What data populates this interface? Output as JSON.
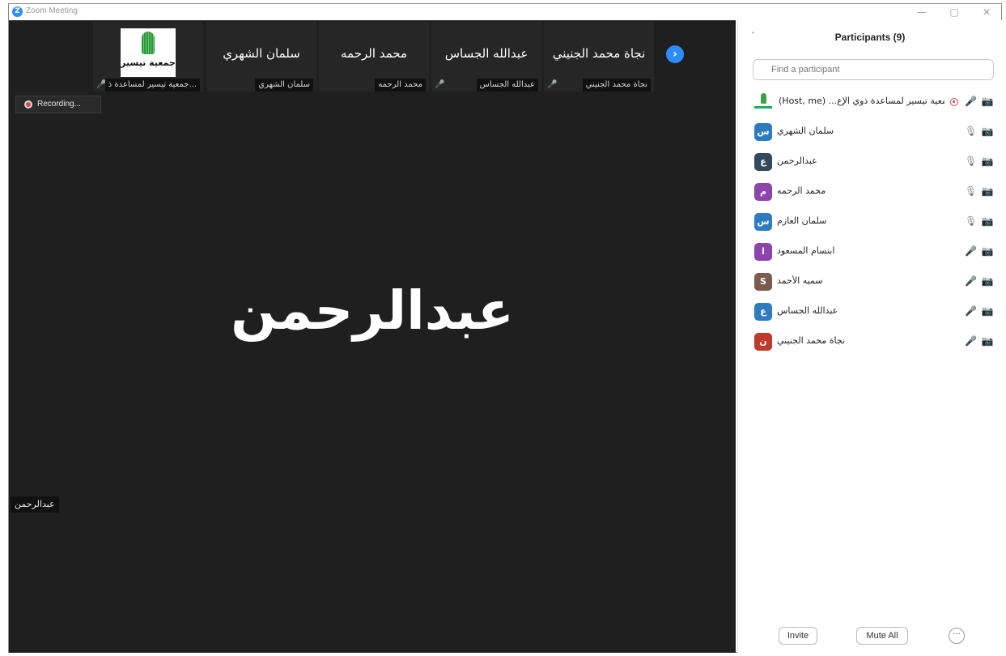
{
  "window": {
    "app_icon_glyph": "Z",
    "title": "Zoom Meeting",
    "controls": {
      "minimize": "—",
      "maximize": "▢",
      "close": "✕"
    }
  },
  "thumbnails": [
    {
      "type": "logo",
      "logo_text": "جمعية تيسير",
      "label": "...جمعية تيسير لمساعدة ذ",
      "muted": true
    },
    {
      "type": "name",
      "big_name": "سلمان الشهري",
      "label": "سلمان الشهري",
      "muted": false
    },
    {
      "type": "name",
      "big_name": "محمد الرحمه",
      "label": "محمد الرحمه",
      "muted": false
    },
    {
      "type": "name",
      "big_name": "عبدالله الجساس",
      "label": "عبدالله الجساس",
      "muted": true
    },
    {
      "type": "name",
      "big_name": "نجاة محمد الجنيني",
      "label": "نجاة محمد الجنيني",
      "muted": true
    }
  ],
  "next_button_glyph": "›",
  "recording": {
    "label": "Recording..."
  },
  "active_speaker": {
    "name": "عبدالرحمن",
    "label": "عبدالرحمن"
  },
  "participants_panel": {
    "collapse_glyph": "˅",
    "title": "Participants (9)",
    "search_placeholder": "Find a participant",
    "participants": [
      {
        "name": "(Host, me) ...جمعية تيسير لمساعدة ذوي الإع",
        "avatar_type": "logo",
        "recording": true,
        "mic": "off",
        "camera": "off"
      },
      {
        "name": "سلمان الشهري",
        "avatar_letter": "س",
        "avatar_color": "#2f7bbf",
        "mic": "on",
        "camera": "off"
      },
      {
        "name": "عبدالرحمن",
        "avatar_letter": "ع",
        "avatar_color": "#34495e",
        "mic": "on",
        "camera": "off"
      },
      {
        "name": "محمد الرحمه",
        "avatar_letter": "م",
        "avatar_color": "#8e44ad",
        "mic": "on",
        "camera": "off"
      },
      {
        "name": "سلمان العازم",
        "avatar_letter": "س",
        "avatar_color": "#2f7bbf",
        "mic": "on",
        "camera": "off"
      },
      {
        "name": "ابتسام المسعود",
        "avatar_letter": "ا",
        "avatar_color": "#8e44ad",
        "mic": "off",
        "camera": "off"
      },
      {
        "name": "سميه الأحمد",
        "avatar_letter": "S",
        "avatar_color": "#7d5a4f",
        "mic": "off",
        "camera": "off"
      },
      {
        "name": "عبدالله الجساس",
        "avatar_letter": "ع",
        "avatar_color": "#2f7bbf",
        "mic": "off",
        "camera": "off"
      },
      {
        "name": "نجاة محمد الجنيني",
        "avatar_letter": "ن",
        "avatar_color": "#c0392b",
        "mic": "off",
        "camera": "off"
      }
    ],
    "footer": {
      "invite_label": "Invite",
      "mute_all_label": "Mute All",
      "more_glyph": "···"
    }
  },
  "icons": {
    "mic_on": "🎙",
    "mic_off": "🎤",
    "camera_off": "📷",
    "muted_thumb": "🎤"
  }
}
